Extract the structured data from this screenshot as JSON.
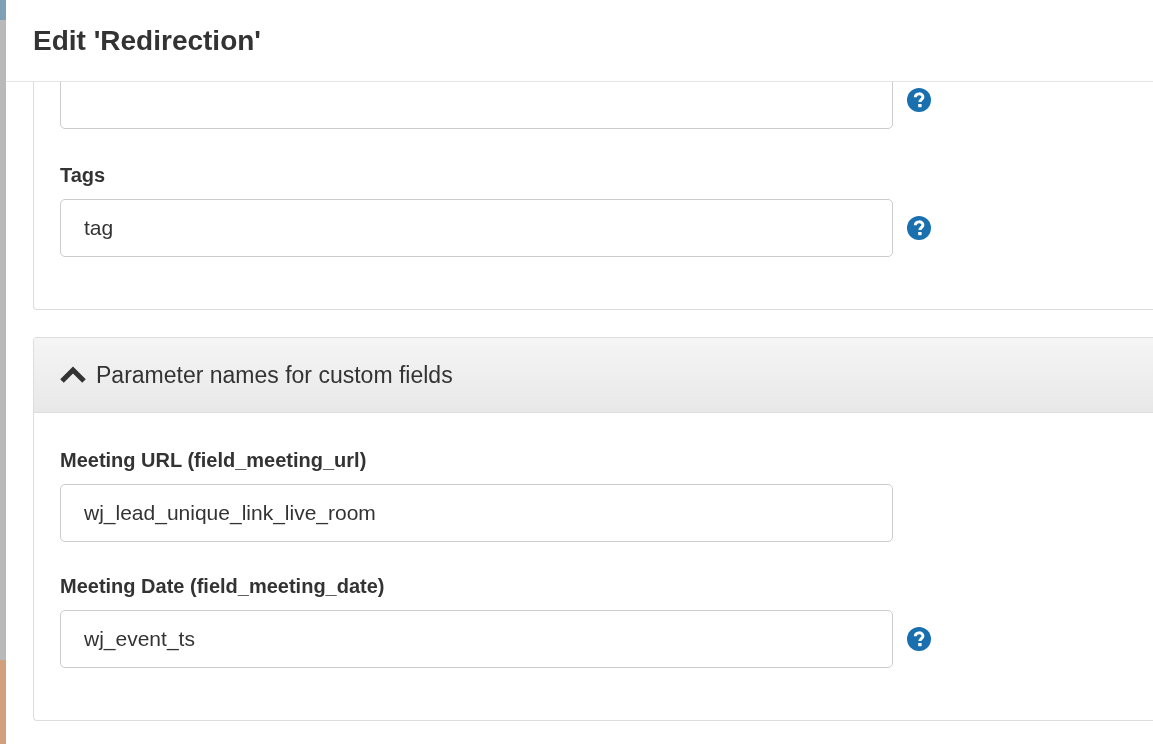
{
  "dialog": {
    "title": "Edit 'Redirection'"
  },
  "sections": [
    {
      "fields": [
        {
          "help": true
        },
        {
          "label": "Tags",
          "value": "tag",
          "help": true
        }
      ]
    },
    {
      "heading": "Parameter names for custom fields",
      "expanded": true,
      "fields": [
        {
          "label": "Meeting URL (field_meeting_url)",
          "value": "wj_lead_unique_link_live_room",
          "help": false
        },
        {
          "label": "Meeting Date (field_meeting_date)",
          "value": "wj_event_ts",
          "help": true
        }
      ]
    }
  ]
}
